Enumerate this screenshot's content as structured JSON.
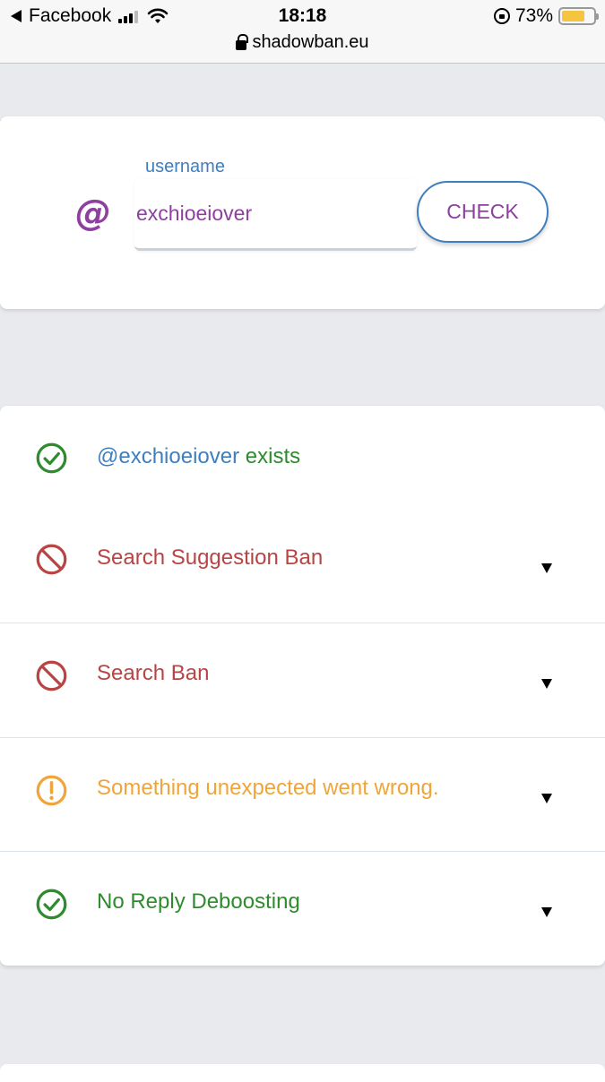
{
  "status_bar": {
    "back_app": "Facebook",
    "time": "18:18",
    "battery_percent": "73%",
    "battery_level": 0.73
  },
  "url_bar": {
    "domain": "shadowban.eu"
  },
  "search": {
    "prefix": "@",
    "label": "username",
    "value": "exchioeiover",
    "button_label": "CHECK"
  },
  "results": {
    "exists": {
      "handle": "@exchioeiover",
      "suffix": " exists",
      "status": "ok"
    },
    "items": [
      {
        "label": "Search Suggestion Ban",
        "status": "banned",
        "icon": "ban-icon"
      },
      {
        "label": "Search Ban",
        "status": "banned",
        "icon": "ban-icon"
      },
      {
        "label": "Something unexpected went wrong.",
        "status": "error",
        "icon": "warning-icon"
      },
      {
        "label": "No Reply Deboosting",
        "status": "ok",
        "icon": "check-circle-icon"
      }
    ]
  },
  "colors": {
    "purple": "#8e3fa0",
    "blue": "#3f7fbf",
    "green": "#2e8b2e",
    "red": "#b84444",
    "orange": "#f0a53a"
  }
}
